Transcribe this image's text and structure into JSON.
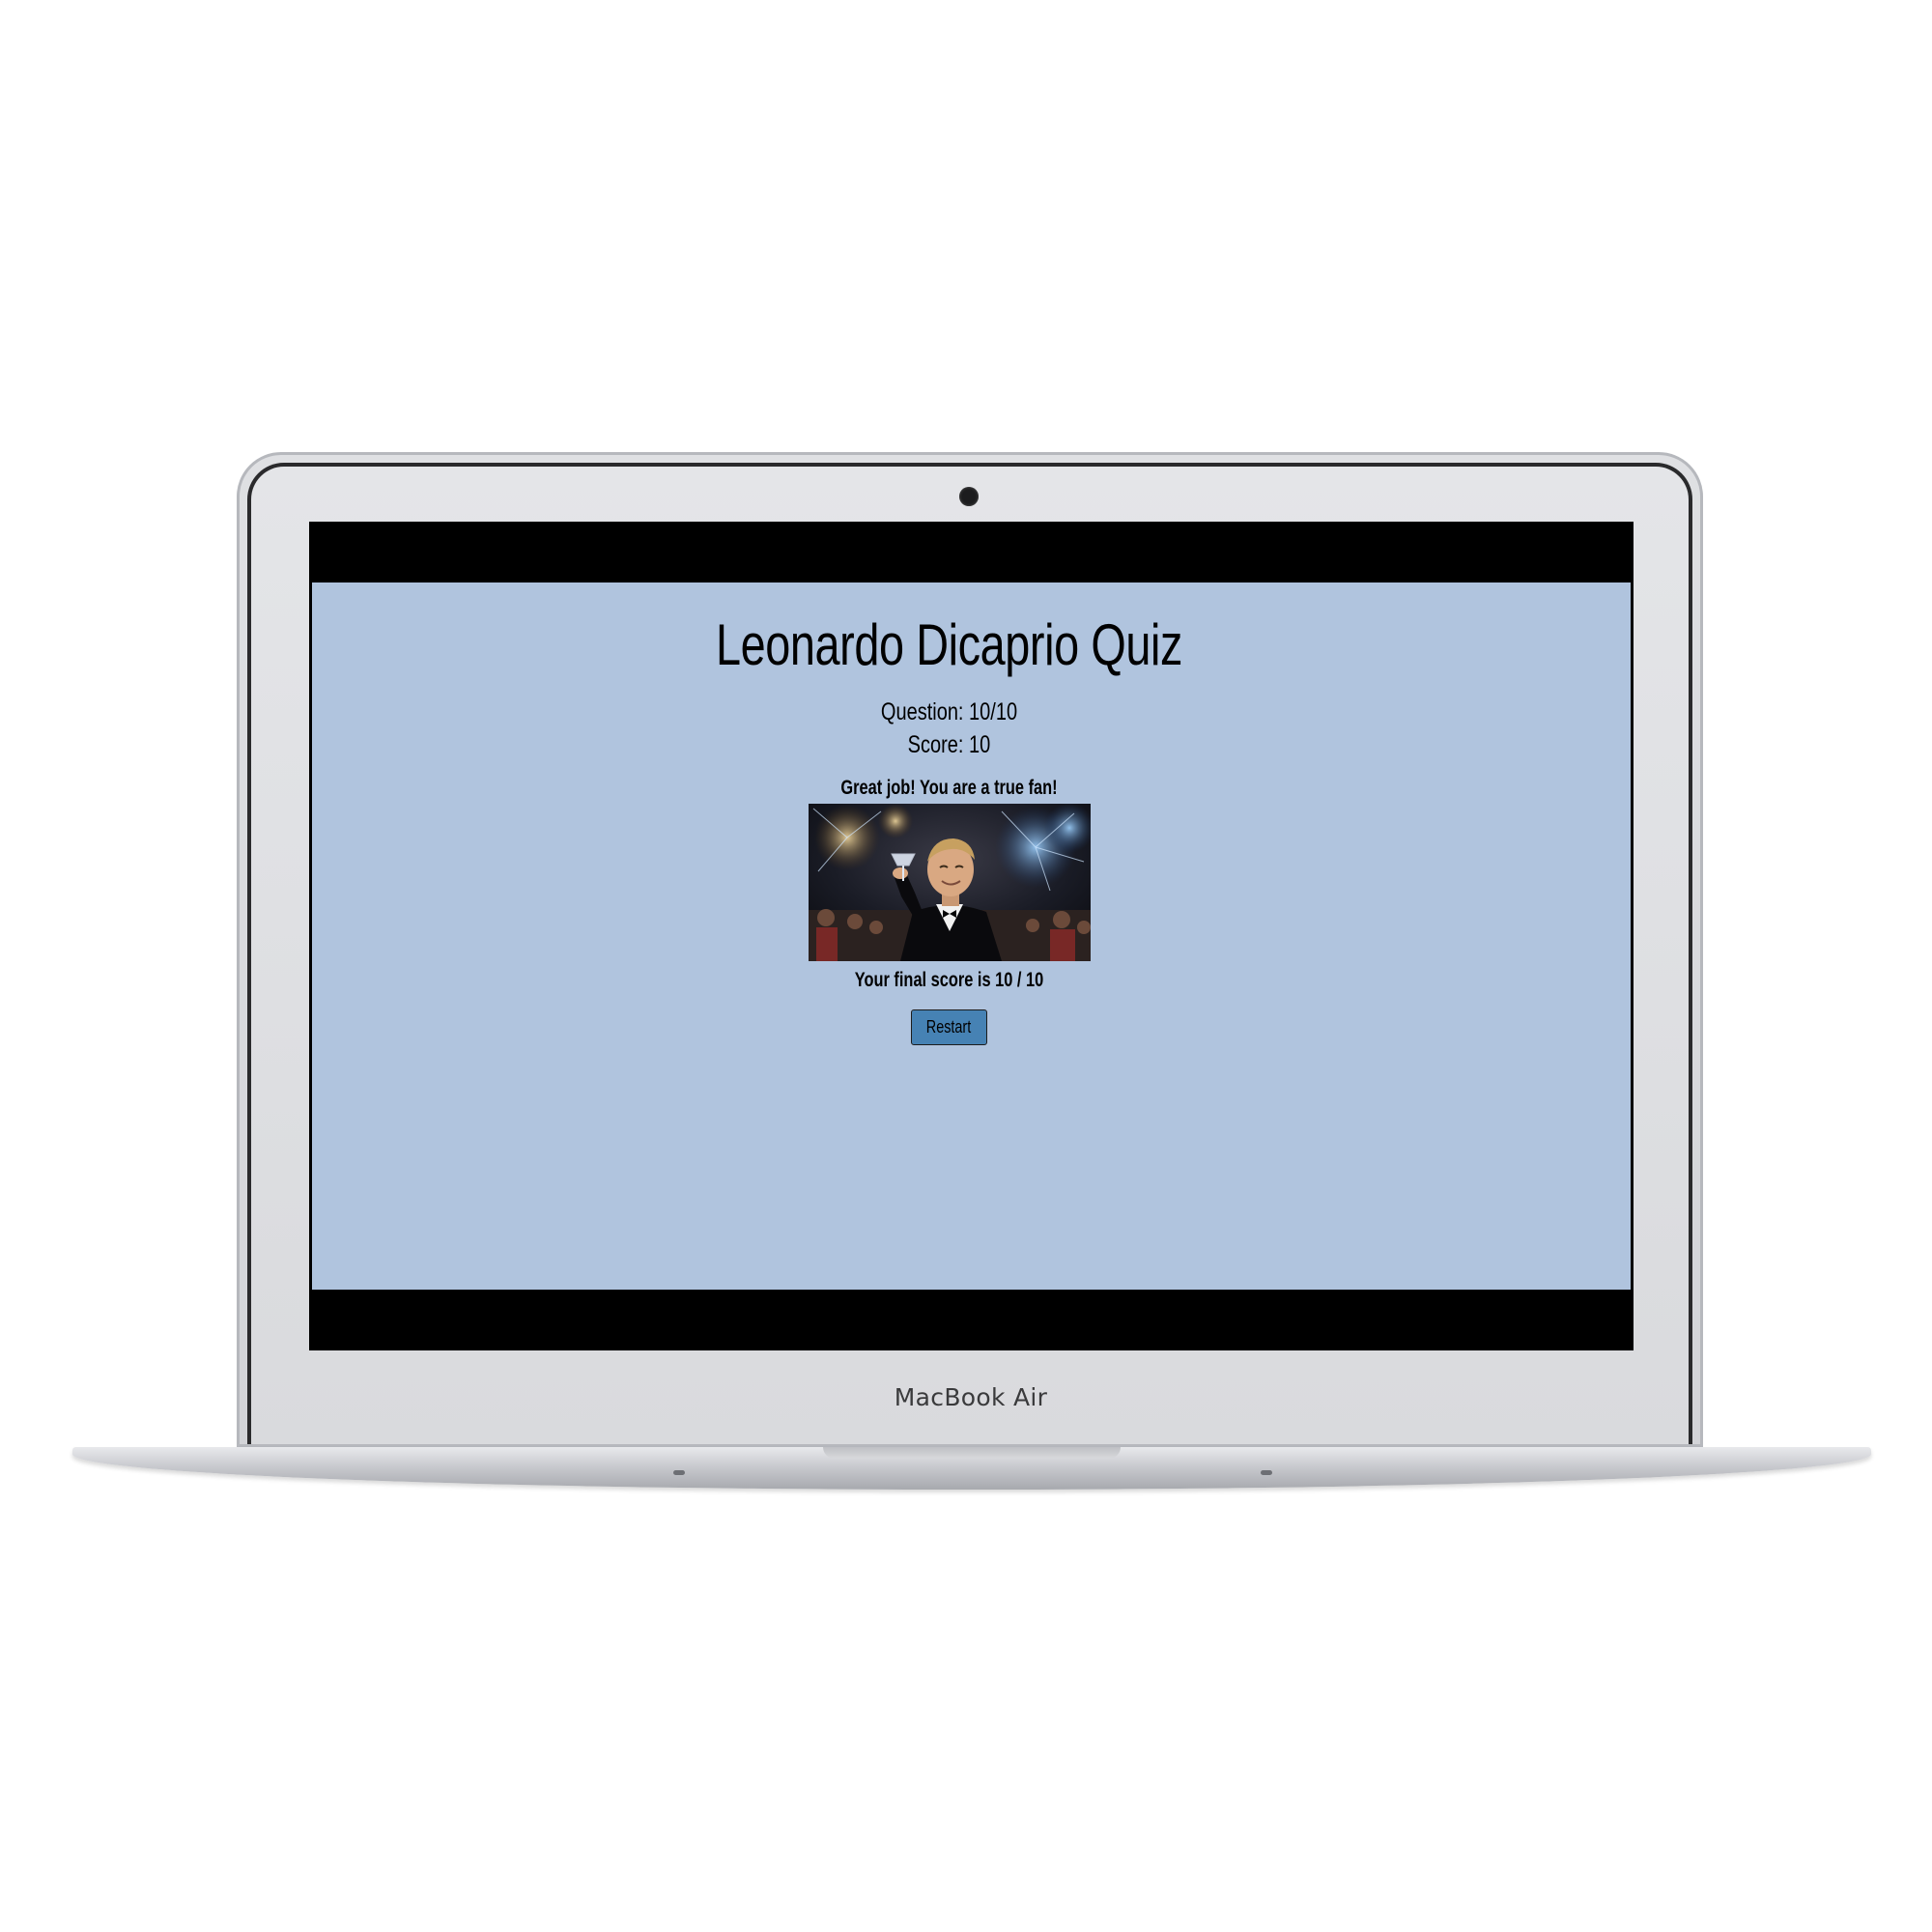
{
  "device": {
    "brand_label": "MacBook Air"
  },
  "quiz": {
    "title": "Leonardo Dicaprio Quiz",
    "question_counter": "Question: 10/10",
    "score_line": "Score: 10",
    "result_message": "Great job! You are a true fan!",
    "final_score": "Your final score is 10 / 10",
    "restart_label": "Restart"
  },
  "result_image": {
    "icon": "celebration-photo"
  },
  "colors": {
    "page_background": "#b0c4de",
    "restart_button": "#4682b4",
    "letterbox": "#000000"
  }
}
